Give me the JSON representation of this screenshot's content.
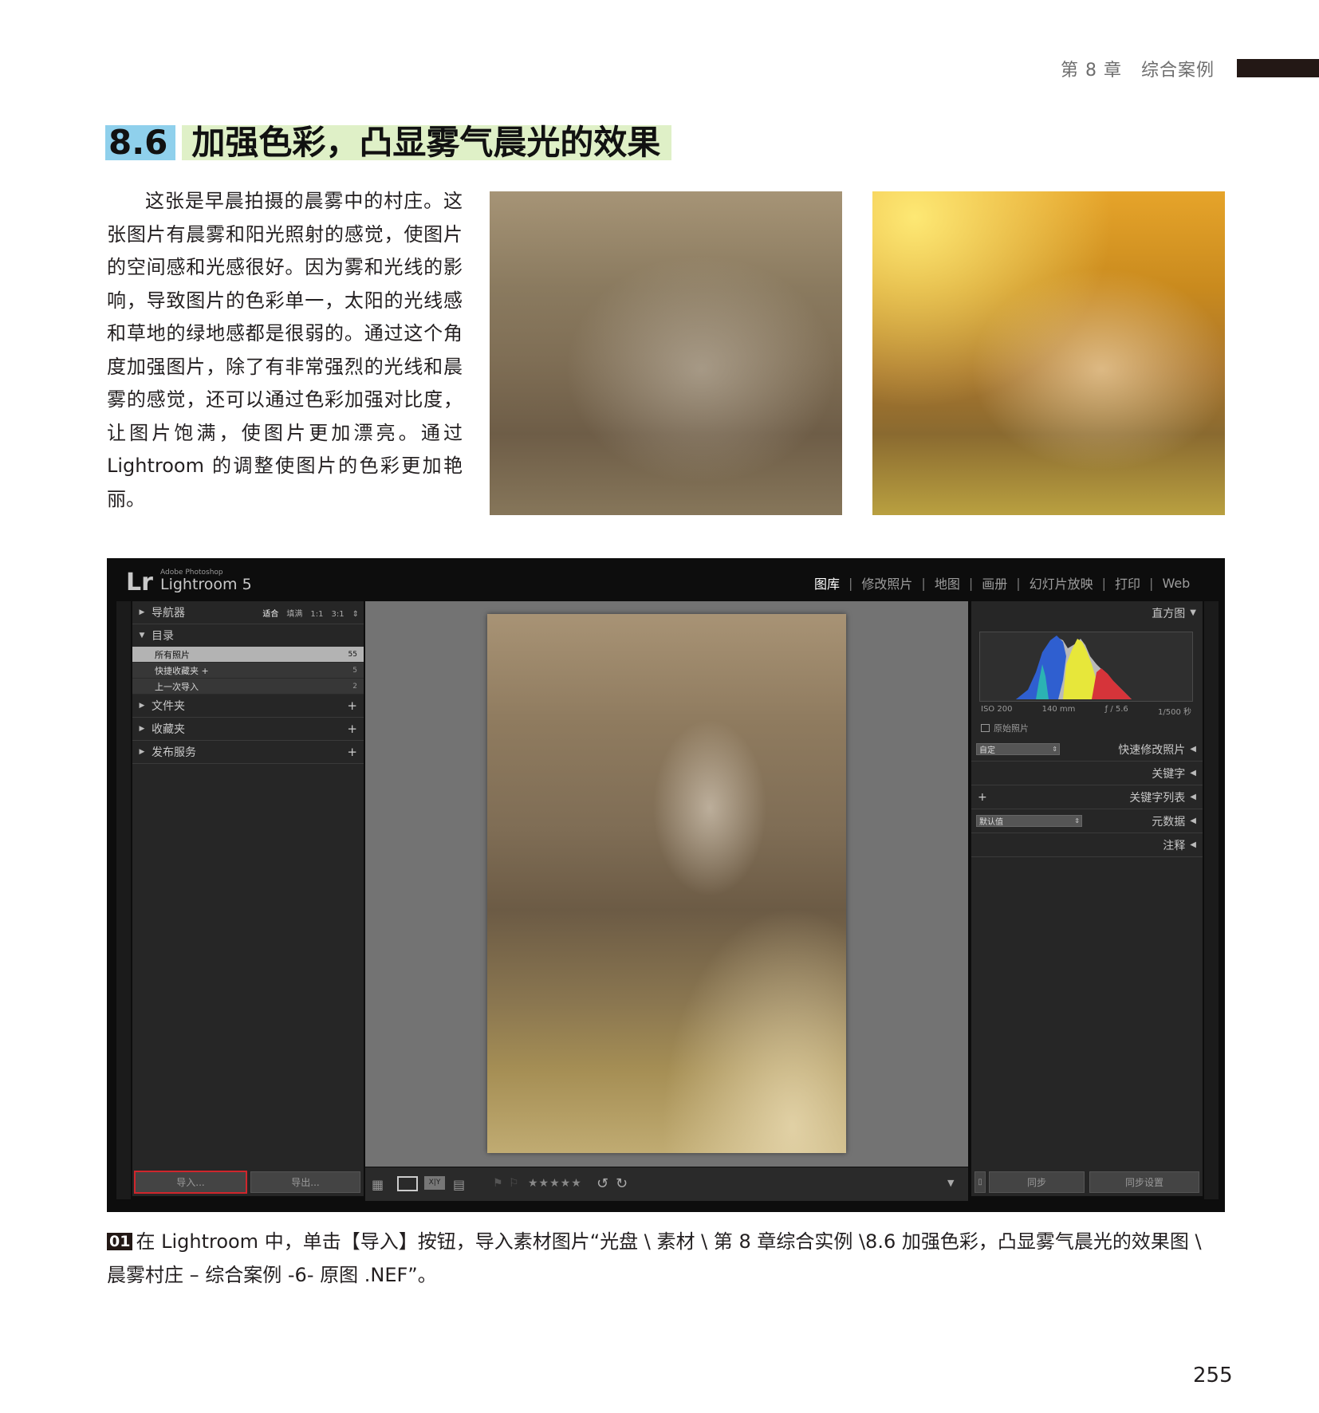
{
  "header": {
    "chapter": "第 8 章",
    "chapter_title": "综合案例"
  },
  "section": {
    "number": "8.6",
    "title": "加强色彩，凸显雾气晨光的效果",
    "intro": "这张是早晨拍摄的晨雾中的村庄。这张图片有晨雾和阳光照射的感觉，使图片的空间感和光感很好。因为雾和光线的影响，导致图片的色彩单一，太阳的光线感和草地的绿地感都是很弱的。通过这个角度加强图片，除了有非常强烈的光线和晨雾的感觉，还可以通过色彩加强对比度，让图片饱满，使图片更加漂亮。通过 Lightroom 的调整使图片的色彩更加艳丽。"
  },
  "lightroom": {
    "logo": "Lr",
    "brand": "Adobe Photoshop",
    "app_name": "Lightroom 5",
    "modules": [
      "图库",
      "修改照片",
      "地图",
      "画册",
      "幻灯片放映",
      "打印",
      "Web"
    ],
    "active_module": "图库",
    "left_panel": {
      "navigator": {
        "label": "导航器",
        "options": [
          "适合",
          "填满",
          "1:1",
          "3:1"
        ],
        "selected_option": "适合"
      },
      "catalog": {
        "label": "目录",
        "items": [
          {
            "label": "所有照片",
            "count": "55"
          },
          {
            "label": "快捷收藏夹 +",
            "count": "5"
          },
          {
            "label": "上一次导入",
            "count": "2"
          }
        ]
      },
      "folders": "文件夹",
      "collections": "收藏夹",
      "publish": "发布服务",
      "plus_glyph": "+",
      "import_button": "导入...",
      "export_button": "导出..."
    },
    "right_panel": {
      "histogram": {
        "label": "直方图",
        "iso": "ISO 200",
        "focal": "140 mm",
        "aperture": "ƒ / 5.6",
        "shutter": "1/500 秒",
        "original_photo": "原始照片"
      },
      "quick_develop": {
        "label": "快速修改照片",
        "preset": "自定"
      },
      "keywording": "关键字",
      "keyword_list": {
        "label": "关键字列表",
        "plus_glyph": "+"
      },
      "metadata": {
        "label": "元数据",
        "preset": "默认值"
      },
      "comments": "注释",
      "sync_button": "同步",
      "sync_settings_button": "同步设置"
    },
    "toolbar": {
      "rating": "★★★★★"
    }
  },
  "caption": {
    "step": "01",
    "text": "在 Lightroom 中，单击【导入】按钮，导入素材图片“光盘 \\ 素材 \\ 第 8 章综合实例 \\8.6 加强色彩，凸显雾气晨光的效果图 \\ 晨雾村庄 – 综合案例 -6- 原图 .NEF”。"
  },
  "page_number": "255",
  "colors": {
    "title_number_bg": "#8fd0ec",
    "title_text_bg": "#dff0c7",
    "lr_background": "#0d0d0d",
    "panel_bg": "#262626",
    "import_highlight": "#d0262c"
  }
}
